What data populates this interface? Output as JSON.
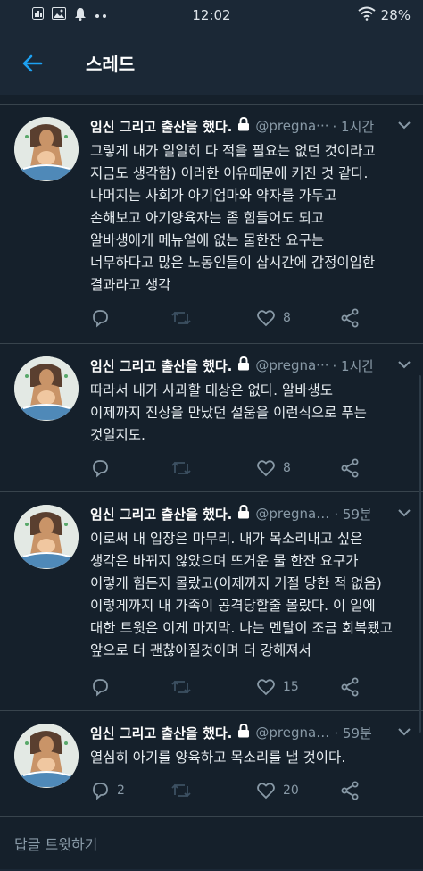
{
  "status_bar": {
    "time": "12:02",
    "battery": "28%",
    "icons": [
      "gallery-notification-icon",
      "image-notification-icon",
      "bell-notification-icon",
      "more-notifications-icon",
      "wifi-icon",
      "battery-icon"
    ]
  },
  "header": {
    "title": "스레드",
    "back_icon": "back-arrow-icon"
  },
  "colors": {
    "accent": "#1da1f2",
    "background": "#15202b",
    "secondary_text": "#8899a6",
    "divider": "#38444d"
  },
  "tweets": [
    {
      "name": "임신 그리고 출산을 했다.",
      "handle": "@pregna···",
      "time": "· 1시간",
      "text": "그렇게 내가 일일히 다 적을 필요는 없던 것이라고\n지금도 생각함) 이러한 이유때문에 커진 것 같다.\n나머지는 사회가 아기엄마와 약자를 가두고\n손해보고 아기양육자는 좀 힘들어도 되고\n알바생에게 메뉴얼에 없는 물한잔 요구는\n너무하다고 많은 노동인들이 삽시간에 감정이입한\n결과라고 생각",
      "replies": "",
      "retweets": "",
      "likes": "8"
    },
    {
      "name": "임신 그리고 출산을 했다.",
      "handle": "@pregna···",
      "time": "· 1시간",
      "text": "따라서 내가 사과할 대상은 없다. 알바생도\n이제까지 진상을 만났던 설움을 이런식으로 푸는\n것일지도.",
      "replies": "",
      "retweets": "",
      "likes": "8"
    },
    {
      "name": "임신 그리고 출산을 했다.",
      "handle": "@pregnan···",
      "time": "· 59분",
      "text": "이로써 내 입장은 마무리. 내가 목소리내고 싶은\n생각은 바뀌지 않았으며 뜨거운 물 한잔 요구가\n이렇게 힘든지 몰랐고(이제까지 거절 당한 적 없음)\n이렇게까지 내 가족이 공격당할줄 몰랐다. 이 일에\n대한 트윗은 이게 마지막. 나는 멘탈이 조금 회복됐고\n앞으로 더 괜찮아질것이며 더 강해져서",
      "replies": "",
      "retweets": "",
      "likes": "15"
    },
    {
      "name": "임신 그리고 출산을 했다.",
      "handle": "@pregnan···",
      "time": "· 59분",
      "text": "열심히 아기를 양육하고 목소리를 낼 것이다.",
      "replies": "2",
      "retweets": "",
      "likes": "20"
    }
  ],
  "reply_bar": {
    "placeholder": "답글 트윗하기"
  }
}
